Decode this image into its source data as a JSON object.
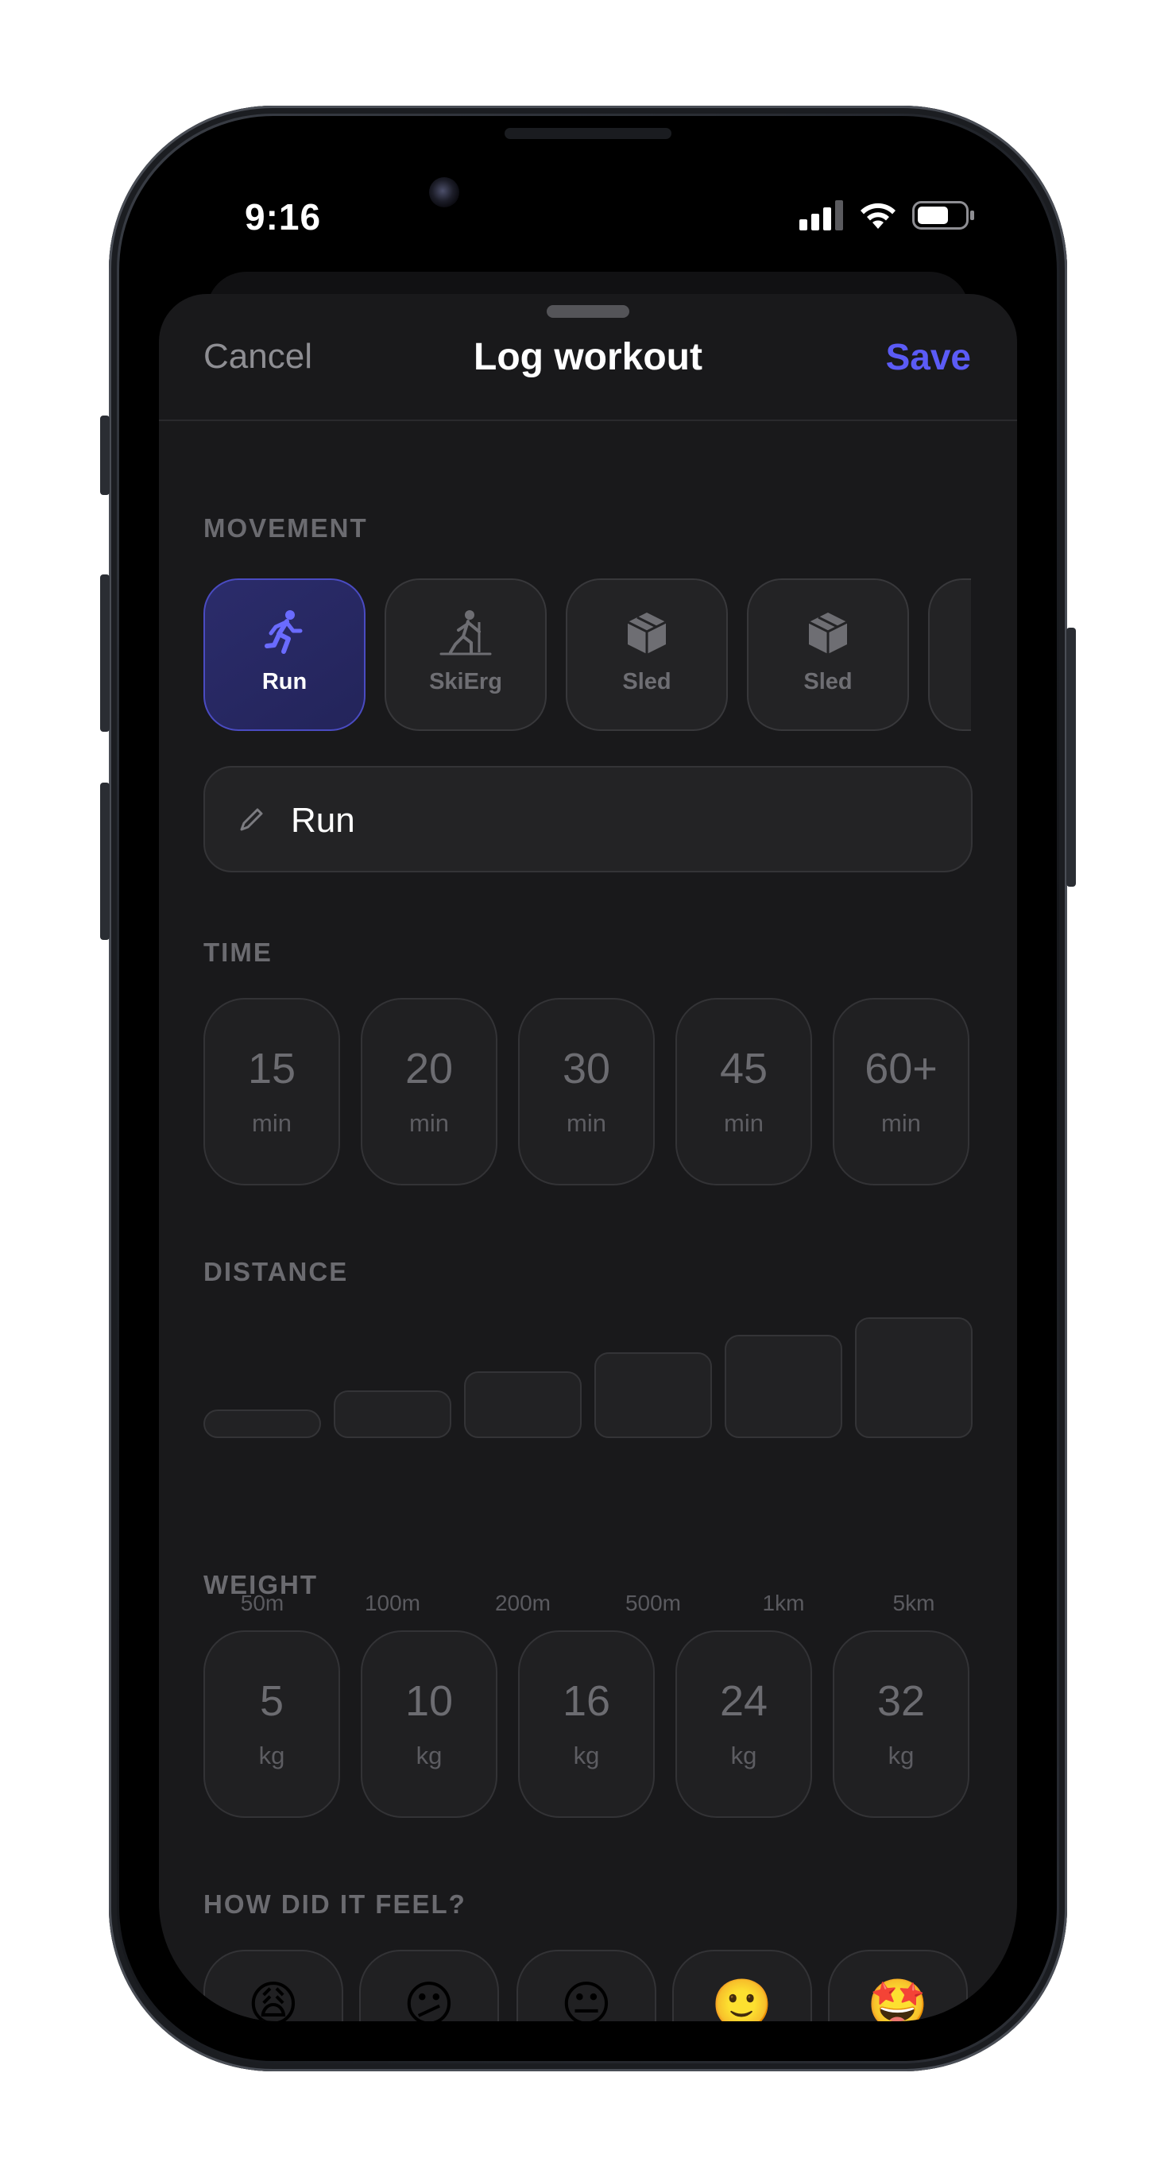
{
  "status_bar": {
    "time": "9:16"
  },
  "nav": {
    "cancel": "Cancel",
    "title": "Log workout",
    "save": "Save",
    "accent_color": "#5b5bf6"
  },
  "movement": {
    "label": "MOVEMENT",
    "items": [
      {
        "label": "Run",
        "icon": "running-icon",
        "selected": true
      },
      {
        "label": "SkiErg",
        "icon": "skier-icon",
        "selected": false
      },
      {
        "label": "Sled",
        "icon": "box-icon",
        "selected": false
      },
      {
        "label": "Sled",
        "icon": "box-icon",
        "selected": false
      }
    ],
    "name_value": "Run"
  },
  "time": {
    "label": "TIME",
    "options": [
      {
        "value": "15",
        "unit": "min"
      },
      {
        "value": "20",
        "unit": "min"
      },
      {
        "value": "30",
        "unit": "min"
      },
      {
        "value": "45",
        "unit": "min"
      },
      {
        "value": "60+",
        "unit": "min"
      }
    ]
  },
  "distance": {
    "label": "DISTANCE",
    "options": [
      "50m",
      "100m",
      "200m",
      "500m",
      "1km",
      "5km"
    ]
  },
  "weight": {
    "label": "WEIGHT",
    "options": [
      {
        "value": "5",
        "unit": "kg"
      },
      {
        "value": "10",
        "unit": "kg"
      },
      {
        "value": "16",
        "unit": "kg"
      },
      {
        "value": "24",
        "unit": "kg"
      },
      {
        "value": "32",
        "unit": "kg"
      }
    ]
  },
  "feel": {
    "label": "HOW DID IT FEEL?",
    "options": [
      "😩",
      "😕",
      "😐",
      "🙂",
      "🤩"
    ]
  }
}
